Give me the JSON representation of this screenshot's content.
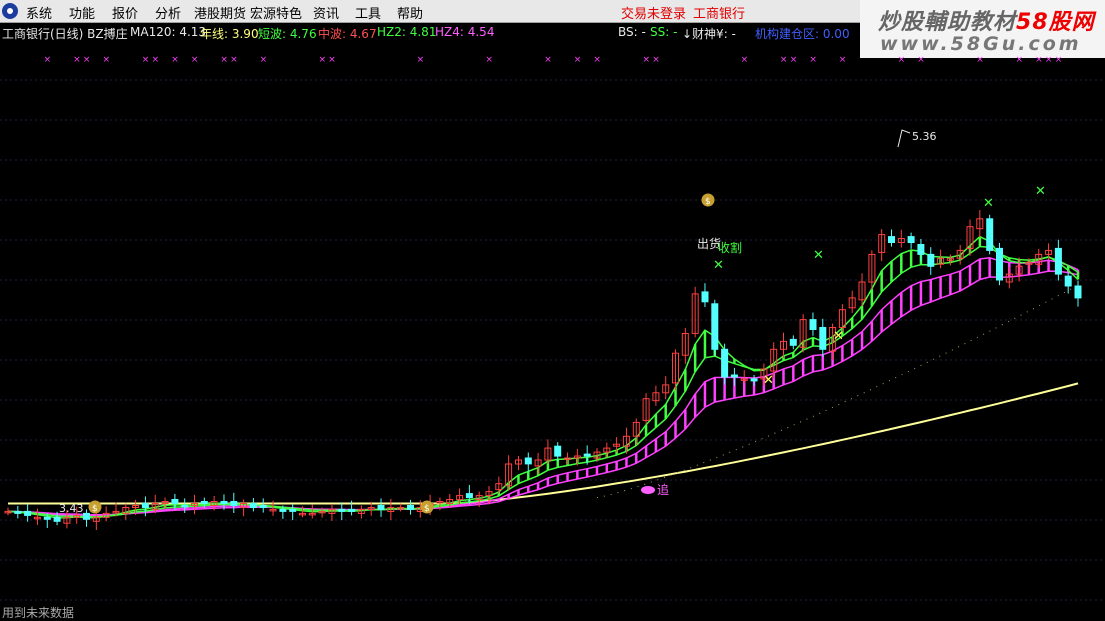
{
  "menu": {
    "items": [
      "系统",
      "功能",
      "报价",
      "分析",
      "港股期货",
      "宏源特色",
      "资讯",
      "工具",
      "帮助"
    ],
    "trade_status": "交易未登录",
    "stock_name": "工商银行"
  },
  "watermark": {
    "title": "炒股輔助教材",
    "title_brand": "58股网",
    "url": "www.58Gu.com"
  },
  "info": {
    "title": "工商银行(日线) BZ搏庄",
    "ma120": "MA120: 4.13",
    "year_line": "年线: 3.90",
    "short_wave": "短波: 4.76",
    "mid_wave": "中波: 4.67",
    "hz2": "HZ2: 4.81",
    "hz4": "HZ4: 4.54",
    "bs": "BS: -",
    "ss": "SS: -",
    "spirit": "↓财神¥: -",
    "zone": "机构建仓区: 0.00"
  },
  "annotations": {
    "high": "5.36",
    "low": "3.43",
    "sell_label": "出货",
    "harvest_label": "收割",
    "chase_label": "追"
  },
  "status": {
    "text": "用到未来数据"
  },
  "colors": {
    "background": "#000000",
    "grid": "#1f1f3d",
    "up_candle": "#ff4040",
    "down_candle": "#54ffff",
    "green_band": "#40ff40",
    "magenta_band": "#ff40ff",
    "year_line": "#ffff99",
    "markers": "#ff40ff"
  },
  "chart_data": {
    "type": "candlestick",
    "high_label": 5.36,
    "low_label": 3.43,
    "prices": [
      3.48,
      3.47,
      3.46,
      3.45,
      3.44,
      3.43,
      3.45,
      3.46,
      3.44,
      3.45,
      3.47,
      3.48,
      3.5,
      3.51,
      3.5,
      3.52,
      3.53,
      3.52,
      3.51,
      3.52,
      3.52,
      3.53,
      3.52,
      3.51,
      3.52,
      3.5,
      3.5,
      3.49,
      3.48,
      3.48,
      3.47,
      3.47,
      3.48,
      3.49,
      3.48,
      3.48,
      3.49,
      3.5,
      3.49,
      3.5,
      3.5,
      3.49,
      3.5,
      3.52,
      3.53,
      3.54,
      3.56,
      3.55,
      3.56,
      3.58,
      3.62,
      3.72,
      3.74,
      3.72,
      3.74,
      3.8,
      3.76,
      3.75,
      3.76,
      3.76,
      3.78,
      3.8,
      3.82,
      3.86,
      3.93,
      4.05,
      4.08,
      4.12,
      4.28,
      4.38,
      4.58,
      4.54,
      4.3,
      4.16,
      4.16,
      4.15,
      4.14,
      4.2,
      4.3,
      4.34,
      4.32,
      4.45,
      4.4,
      4.3,
      4.41,
      4.5,
      4.56,
      4.64,
      4.78,
      4.88,
      4.84,
      4.86,
      4.84,
      4.78,
      4.72,
      4.76,
      4.76,
      4.8,
      4.92,
      4.96,
      4.8,
      4.65,
      4.68,
      4.72,
      4.74,
      4.78,
      4.8,
      4.68,
      4.62,
      4.56
    ]
  }
}
